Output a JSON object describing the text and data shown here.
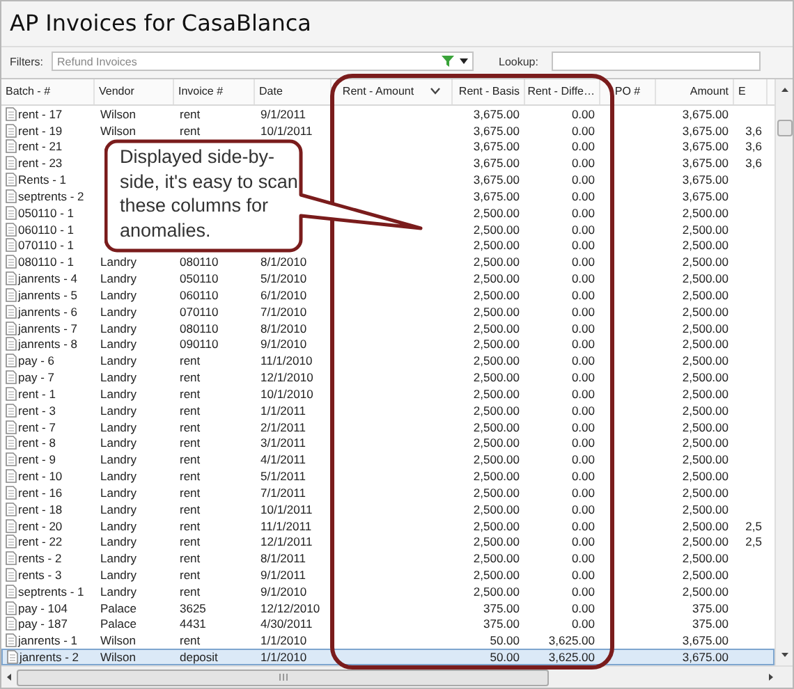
{
  "title": "AP Invoices for CasaBlanca",
  "filters": {
    "label": "Filters:",
    "value": "Refund Invoices"
  },
  "lookup": {
    "label": "Lookup:"
  },
  "table": {
    "columns": [
      "Batch - #",
      "Vendor",
      "Invoice #",
      "Date",
      "Rent - Amount",
      "Rent - Basis",
      "Rent - Diffe…",
      "PO #",
      "Amount",
      "E"
    ],
    "rows": [
      {
        "cells": [
          "rent - 17",
          "Wilson",
          "rent",
          "9/1/2011",
          null,
          "3,675.00",
          "0.00",
          null,
          "3,675.00",
          null
        ],
        "selected": false
      },
      {
        "cells": [
          "rent - 19",
          "Wilson",
          "rent",
          "10/1/2011",
          null,
          "3,675.00",
          "0.00",
          null,
          "3,675.00",
          "3,6"
        ],
        "selected": false
      },
      {
        "cells": [
          "rent - 21",
          null,
          null,
          null,
          null,
          "3,675.00",
          "0.00",
          null,
          "3,675.00",
          "3,6"
        ],
        "selected": false
      },
      {
        "cells": [
          "rent - 23",
          null,
          null,
          null,
          null,
          "3,675.00",
          "0.00",
          null,
          "3,675.00",
          "3,6"
        ],
        "selected": false
      },
      {
        "cells": [
          "Rents - 1",
          null,
          null,
          null,
          null,
          "3,675.00",
          "0.00",
          null,
          "3,675.00",
          null
        ],
        "selected": false
      },
      {
        "cells": [
          "septrents - 2",
          null,
          null,
          null,
          null,
          "3,675.00",
          "0.00",
          null,
          "3,675.00",
          null
        ],
        "selected": false
      },
      {
        "cells": [
          "050110 - 1",
          null,
          null,
          null,
          null,
          "2,500.00",
          "0.00",
          null,
          "2,500.00",
          null
        ],
        "selected": false
      },
      {
        "cells": [
          "060110 - 1",
          null,
          null,
          null,
          null,
          "2,500.00",
          "0.00",
          null,
          "2,500.00",
          null
        ],
        "selected": false
      },
      {
        "cells": [
          "070110 - 1",
          null,
          null,
          null,
          null,
          "2,500.00",
          "0.00",
          null,
          "2,500.00",
          null
        ],
        "selected": false
      },
      {
        "cells": [
          "080110 - 1",
          "Landry",
          "080110",
          "8/1/2010",
          null,
          "2,500.00",
          "0.00",
          null,
          "2,500.00",
          null
        ],
        "selected": false
      },
      {
        "cells": [
          "janrents - 4",
          "Landry",
          "050110",
          "5/1/2010",
          null,
          "2,500.00",
          "0.00",
          null,
          "2,500.00",
          null
        ],
        "selected": false
      },
      {
        "cells": [
          "janrents - 5",
          "Landry",
          "060110",
          "6/1/2010",
          null,
          "2,500.00",
          "0.00",
          null,
          "2,500.00",
          null
        ],
        "selected": false
      },
      {
        "cells": [
          "janrents - 6",
          "Landry",
          "070110",
          "7/1/2010",
          null,
          "2,500.00",
          "0.00",
          null,
          "2,500.00",
          null
        ],
        "selected": false
      },
      {
        "cells": [
          "janrents - 7",
          "Landry",
          "080110",
          "8/1/2010",
          null,
          "2,500.00",
          "0.00",
          null,
          "2,500.00",
          null
        ],
        "selected": false
      },
      {
        "cells": [
          "janrents - 8",
          "Landry",
          "090110",
          "9/1/2010",
          null,
          "2,500.00",
          "0.00",
          null,
          "2,500.00",
          null
        ],
        "selected": false
      },
      {
        "cells": [
          "pay - 6",
          "Landry",
          "rent",
          "11/1/2010",
          null,
          "2,500.00",
          "0.00",
          null,
          "2,500.00",
          null
        ],
        "selected": false
      },
      {
        "cells": [
          "pay - 7",
          "Landry",
          "rent",
          "12/1/2010",
          null,
          "2,500.00",
          "0.00",
          null,
          "2,500.00",
          null
        ],
        "selected": false
      },
      {
        "cells": [
          "rent - 1",
          "Landry",
          "rent",
          "10/1/2010",
          null,
          "2,500.00",
          "0.00",
          null,
          "2,500.00",
          null
        ],
        "selected": false
      },
      {
        "cells": [
          "rent - 3",
          "Landry",
          "rent",
          "1/1/2011",
          null,
          "2,500.00",
          "0.00",
          null,
          "2,500.00",
          null
        ],
        "selected": false
      },
      {
        "cells": [
          "rent - 7",
          "Landry",
          "rent",
          "2/1/2011",
          null,
          "2,500.00",
          "0.00",
          null,
          "2,500.00",
          null
        ],
        "selected": false
      },
      {
        "cells": [
          "rent - 8",
          "Landry",
          "rent",
          "3/1/2011",
          null,
          "2,500.00",
          "0.00",
          null,
          "2,500.00",
          null
        ],
        "selected": false
      },
      {
        "cells": [
          "rent - 9",
          "Landry",
          "rent",
          "4/1/2011",
          null,
          "2,500.00",
          "0.00",
          null,
          "2,500.00",
          null
        ],
        "selected": false
      },
      {
        "cells": [
          "rent - 10",
          "Landry",
          "rent",
          "5/1/2011",
          null,
          "2,500.00",
          "0.00",
          null,
          "2,500.00",
          null
        ],
        "selected": false
      },
      {
        "cells": [
          "rent - 16",
          "Landry",
          "rent",
          "7/1/2011",
          null,
          "2,500.00",
          "0.00",
          null,
          "2,500.00",
          null
        ],
        "selected": false
      },
      {
        "cells": [
          "rent - 18",
          "Landry",
          "rent",
          "10/1/2011",
          null,
          "2,500.00",
          "0.00",
          null,
          "2,500.00",
          null
        ],
        "selected": false
      },
      {
        "cells": [
          "rent - 20",
          "Landry",
          "rent",
          "11/1/2011",
          null,
          "2,500.00",
          "0.00",
          null,
          "2,500.00",
          "2,5"
        ],
        "selected": false
      },
      {
        "cells": [
          "rent - 22",
          "Landry",
          "rent",
          "12/1/2011",
          null,
          "2,500.00",
          "0.00",
          null,
          "2,500.00",
          "2,5"
        ],
        "selected": false
      },
      {
        "cells": [
          "rents - 2",
          "Landry",
          "rent",
          "8/1/2011",
          null,
          "2,500.00",
          "0.00",
          null,
          "2,500.00",
          null
        ],
        "selected": false
      },
      {
        "cells": [
          "rents - 3",
          "Landry",
          "rent",
          "9/1/2011",
          null,
          "2,500.00",
          "0.00",
          null,
          "2,500.00",
          null
        ],
        "selected": false
      },
      {
        "cells": [
          "septrents - 1",
          "Landry",
          "rent",
          "9/1/2010",
          null,
          "2,500.00",
          "0.00",
          null,
          "2,500.00",
          null
        ],
        "selected": false
      },
      {
        "cells": [
          "pay - 104",
          "Palace",
          "3625",
          "12/12/2010",
          null,
          "375.00",
          "0.00",
          null,
          "375.00",
          null
        ],
        "selected": false
      },
      {
        "cells": [
          "pay - 187",
          "Palace",
          "4431",
          "4/30/2011",
          null,
          "375.00",
          "0.00",
          null,
          "375.00",
          null
        ],
        "selected": false
      },
      {
        "cells": [
          "janrents - 1",
          "Wilson",
          "rent",
          "1/1/2010",
          null,
          "50.00",
          "3,625.00",
          null,
          "3,675.00",
          null
        ],
        "selected": false
      },
      {
        "cells": [
          "janrents - 2",
          "Wilson",
          "deposit",
          "1/1/2010",
          null,
          "50.00",
          "3,625.00",
          null,
          "3,675.00",
          null
        ],
        "selected": true
      }
    ]
  },
  "callout": "Displayed side-by-side, it's easy to scan these columns for anomalies."
}
